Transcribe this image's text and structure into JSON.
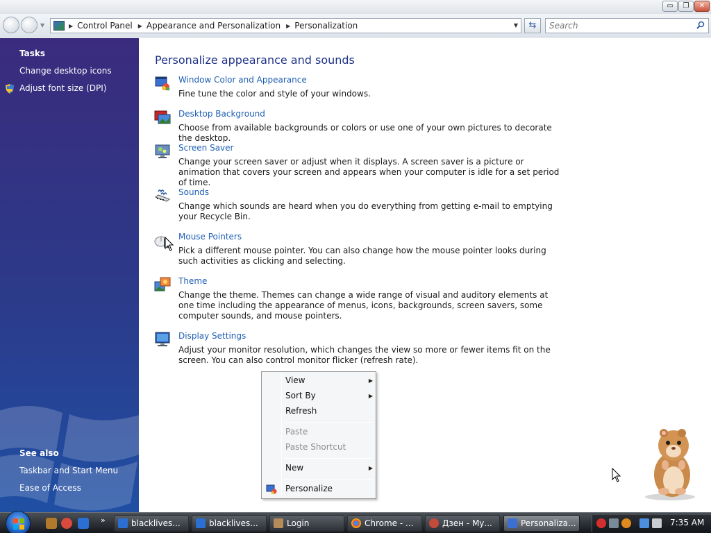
{
  "window": {
    "controls": {
      "minimize": "▭",
      "maximize": "❐",
      "close": "✕"
    }
  },
  "navbar": {
    "breadcrumbs": [
      "Control Panel",
      "Appearance and Personalization",
      "Personalization"
    ],
    "search_placeholder": "Search",
    "refresh_glyph": "⇆"
  },
  "sidebar": {
    "tasks_heading": "Tasks",
    "tasks": [
      "Change desktop icons",
      "Adjust font size (DPI)"
    ],
    "see_also_heading": "See also",
    "see_also": [
      "Taskbar and Start Menu",
      "Ease of Access"
    ]
  },
  "main": {
    "title": "Personalize appearance and sounds",
    "items": [
      {
        "title": "Window Color and Appearance",
        "desc": "Fine tune the color and style of your windows.",
        "icon": "window-color-icon"
      },
      {
        "title": "Desktop Background",
        "desc": "Choose from available backgrounds or colors or use one of your own pictures to decorate the desktop.",
        "icon": "desktop-background-icon"
      },
      {
        "title": "Screen Saver",
        "desc": "Change your screen saver or adjust when it displays. A screen saver is a picture or animation that covers your screen and appears when your computer is idle for a set period of time.",
        "icon": "screen-saver-icon"
      },
      {
        "title": "Sounds",
        "desc": "Change which sounds are heard when you do everything from getting e-mail to emptying your Recycle Bin.",
        "icon": "sounds-icon"
      },
      {
        "title": "Mouse Pointers",
        "desc": "Pick a different mouse pointer. You can also change how the mouse pointer looks during such activities as clicking and selecting.",
        "icon": "mouse-pointers-icon"
      },
      {
        "title": "Theme",
        "desc": "Change the theme. Themes can change a wide range of visual and auditory elements at one time including the appearance of menus, icons, backgrounds, screen savers, some computer sounds, and mouse pointers.",
        "icon": "theme-icon"
      },
      {
        "title": "Display Settings",
        "desc": "Adjust your monitor resolution, which changes the view so more or fewer items fit on the screen. You can also control monitor flicker (refresh rate).",
        "icon": "display-settings-icon"
      }
    ]
  },
  "context_menu": {
    "view": "View",
    "sort_by": "Sort By",
    "refresh": "Refresh",
    "paste": "Paste",
    "paste_shortcut": "Paste Shortcut",
    "new": "New",
    "personalize": "Personalize",
    "submenu_arrow": "▶"
  },
  "taskbar": {
    "quicklaunch_more": "»",
    "buttons": [
      "blacklives...",
      "blacklives...",
      "Login",
      "Chrome - ...",
      "Дзен - Му...",
      "Personaliza..."
    ],
    "clock": "7:35 AM"
  },
  "colors": {
    "link": "#1e5fb3",
    "title": "#1e3287",
    "sidebar_top": "#3a2b7d",
    "sidebar_bottom": "#1f4fa3"
  }
}
